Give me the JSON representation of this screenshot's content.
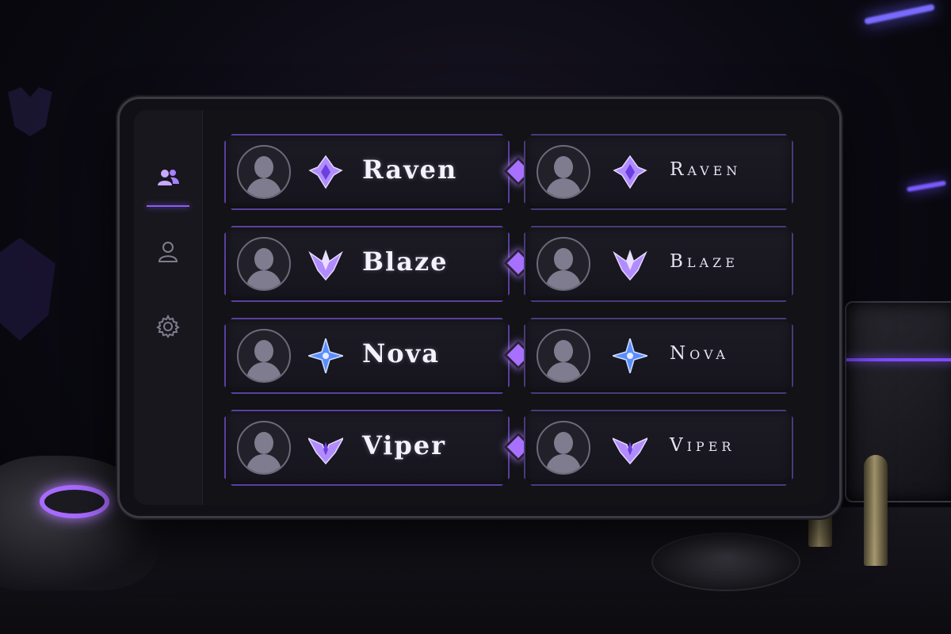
{
  "colors": {
    "accent": "#8b5cf6",
    "rank_violet": "#b18cff",
    "rank_blue": "#5b8dff"
  },
  "sidebar": {
    "items": [
      {
        "icon": "users-icon",
        "active": true
      },
      {
        "icon": "user-icon",
        "active": false
      },
      {
        "icon": "gear-icon",
        "active": false
      }
    ]
  },
  "pairs": [
    {
      "left_name": "Raven",
      "right_name": "Raven",
      "rank_icon": "rank-emblem-violet-icon"
    },
    {
      "left_name": "Blaze",
      "right_name": "Blaze",
      "rank_icon": "rank-chevron-violet-icon"
    },
    {
      "left_name": "Nova",
      "right_name": "Nova",
      "rank_icon": "rank-star-blue-icon"
    },
    {
      "left_name": "Viper",
      "right_name": "Viper",
      "rank_icon": "rank-wings-violet-icon"
    }
  ]
}
